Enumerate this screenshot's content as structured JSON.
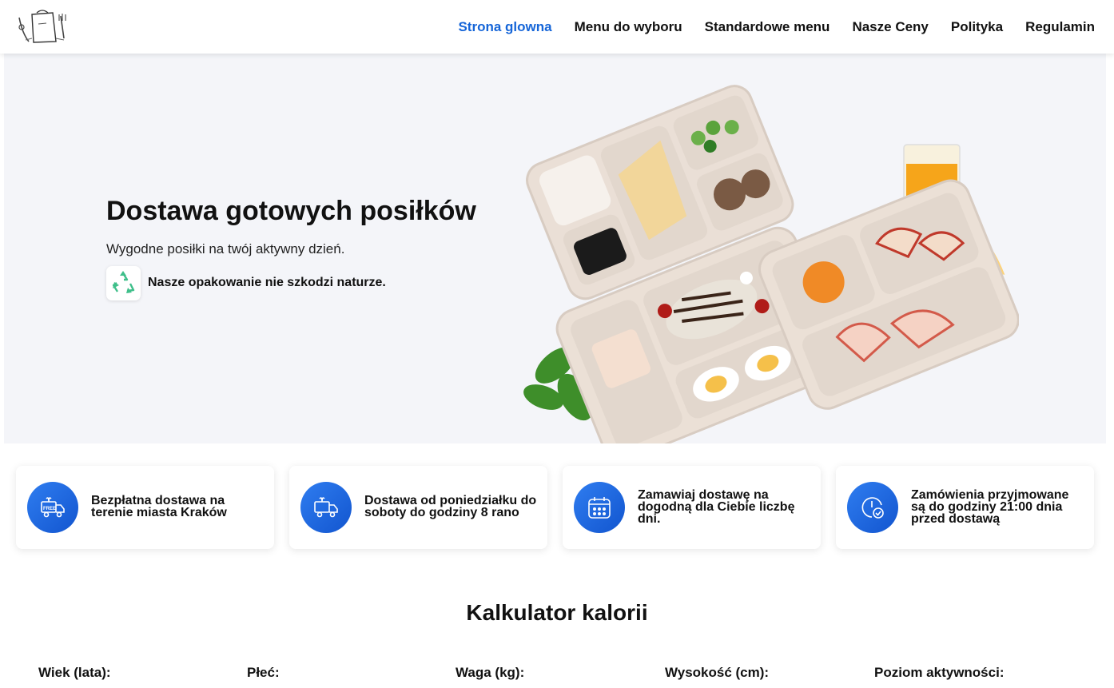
{
  "header": {
    "nav": [
      {
        "label": "Strona glowna",
        "active": true
      },
      {
        "label": "Menu do wyboru",
        "active": false
      },
      {
        "label": "Standardowe menu",
        "active": false
      },
      {
        "label": "Nasze Ceny",
        "active": false
      },
      {
        "label": "Polityka",
        "active": false
      },
      {
        "label": "Regulamin",
        "active": false
      }
    ],
    "logo_icon": "chef-bag-logo-icon"
  },
  "hero": {
    "title": "Dostawa gotowych posiłków",
    "subtitle": "Wygodne posiłki na twój aktywny dzień.",
    "eco_text": "Nasze opakowanie nie szkodzi naturze.",
    "eco_icon": "recycle-icon",
    "image": "meal-trays-image"
  },
  "features": [
    {
      "text": "Bezpłatna dostawa na terenie miasta Kraków",
      "icon": "free-delivery-truck-icon"
    },
    {
      "text": "Dostawa od poniedziałku do soboty do godziny 8 rano",
      "icon": "delivery-truck-icon"
    },
    {
      "text": "Zamawiaj dostawę na dogodną dla Ciebie liczbę dni.",
      "icon": "calendar-icon"
    },
    {
      "text": "Zamówienia przyjmowane są do godziny 21:00 dnia przed dostawą",
      "icon": "clock-check-icon"
    }
  ],
  "calculator": {
    "title": "Kalkulator kalorii",
    "labels": [
      "Wiek (lata):",
      "Płeć:",
      "Waga (kg):",
      "Wysokość (cm):",
      "Poziom aktywności:"
    ]
  },
  "colors": {
    "accent": "#1565d8",
    "hero_bg": "#f4f5f9",
    "icon_blue": "#1a63dc",
    "eco_green": "#3fbf8a"
  }
}
